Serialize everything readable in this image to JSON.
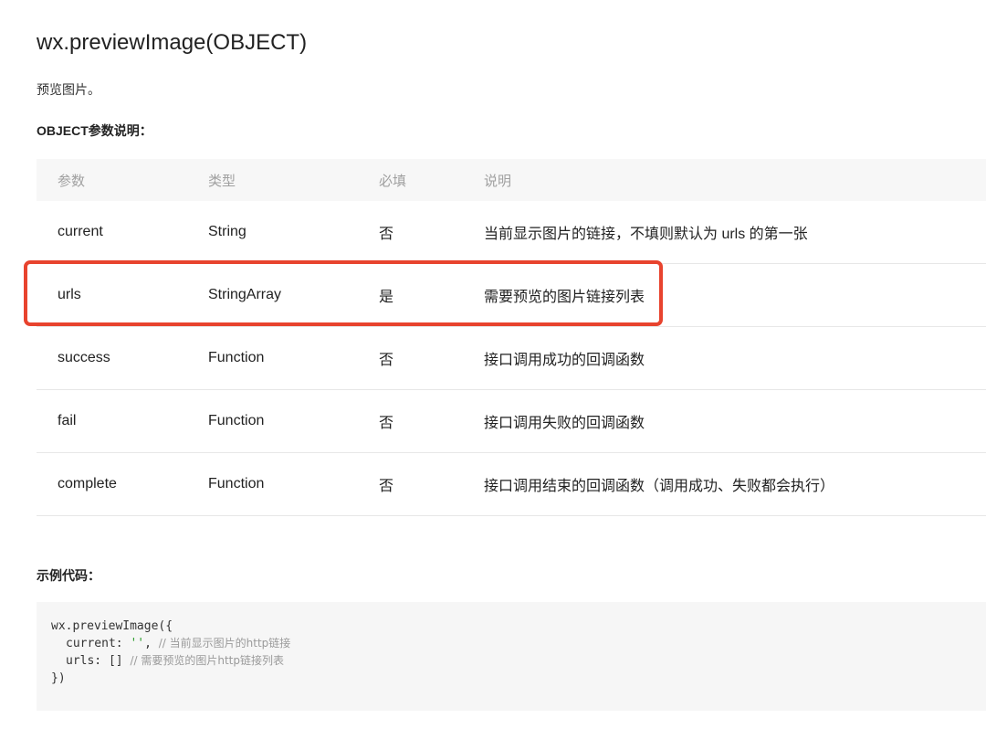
{
  "page": {
    "title": "wx.previewImage(OBJECT)",
    "description": "预览图片。",
    "param_section_label": "OBJECT参数说明：",
    "example_section_label": "示例代码："
  },
  "table": {
    "headers": [
      "参数",
      "类型",
      "必填",
      "说明"
    ],
    "rows": [
      {
        "name": "current",
        "type": "String",
        "required": "否",
        "desc": "当前显示图片的链接，不填则默认为 urls 的第一张"
      },
      {
        "name": "urls",
        "type": "StringArray",
        "required": "是",
        "desc": "需要预览的图片链接列表"
      },
      {
        "name": "success",
        "type": "Function",
        "required": "否",
        "desc": "接口调用成功的回调函数"
      },
      {
        "name": "fail",
        "type": "Function",
        "required": "否",
        "desc": "接口调用失败的回调函数"
      },
      {
        "name": "complete",
        "type": "Function",
        "required": "否",
        "desc": "接口调用结束的回调函数（调用成功、失败都会执行）"
      }
    ],
    "highlighted_row": "urls"
  },
  "code": {
    "line1": "wx.previewImage({",
    "line2_key": "current: ",
    "line2_str": "''",
    "line2_comma": ", ",
    "line2_comment": "// 当前显示图片的http链接",
    "line3_key": "urls: [] ",
    "line3_comment": "// 需要预览的图片http链接列表",
    "line4": "})"
  },
  "colors": {
    "highlight_border": "#e8432e",
    "table_header_bg": "#f7f7f7",
    "code_bg": "#f6f6f6",
    "code_string": "#2a9d2a"
  }
}
